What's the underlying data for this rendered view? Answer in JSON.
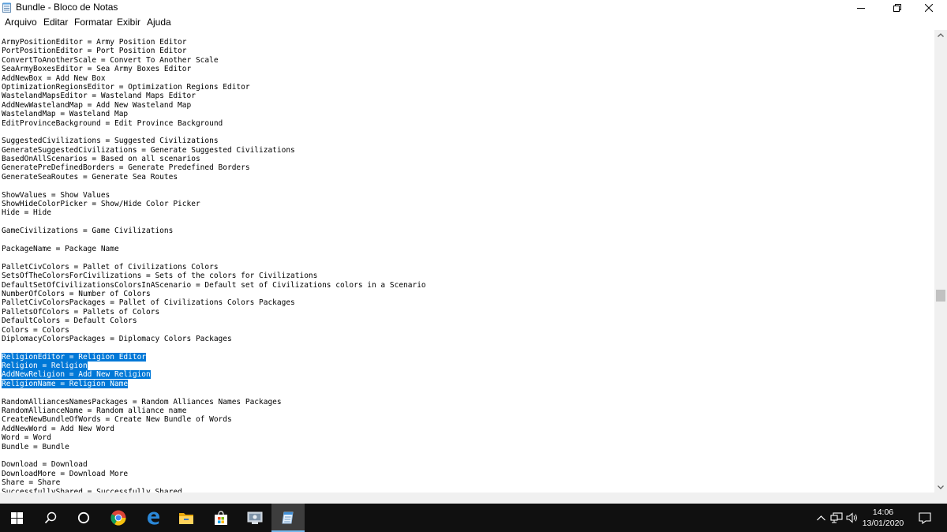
{
  "window": {
    "title": "Bundle - Bloco de Notas"
  },
  "menu": [
    "Arquivo",
    "Editar",
    "Formatar",
    "Exibir",
    "Ajuda"
  ],
  "editor": {
    "lines": [
      {
        "text": "ArmyPositionEditor = Army Position Editor"
      },
      {
        "text": "PortPositionEditor = Port Position Editor"
      },
      {
        "text": "ConvertToAnotherScale = Convert To Another Scale"
      },
      {
        "text": "SeaArmyBoxesEditor = Sea Army Boxes Editor"
      },
      {
        "text": "AddNewBox = Add New Box"
      },
      {
        "text": "OptimizationRegionsEditor = Optimization Regions Editor"
      },
      {
        "text": "WastelandMapsEditor = Wasteland Maps Editor"
      },
      {
        "text": "AddNewWastelandMap = Add New Wasteland Map"
      },
      {
        "text": "WastelandMap = Wasteland Map"
      },
      {
        "text": "EditProvinceBackground = Edit Province Background"
      },
      {
        "text": ""
      },
      {
        "text": "SuggestedCivilizations = Suggested Civilizations"
      },
      {
        "text": "GenerateSuggestedCivilizations = Generate Suggested Civilizations"
      },
      {
        "text": "BasedOnAllScenarios = Based on all scenarios"
      },
      {
        "text": "GeneratePreDefinedBorders = Generate Predefined Borders"
      },
      {
        "text": "GenerateSeaRoutes = Generate Sea Routes"
      },
      {
        "text": ""
      },
      {
        "text": "ShowValues = Show Values"
      },
      {
        "text": "ShowHideColorPicker = Show/Hide Color Picker"
      },
      {
        "text": "Hide = Hide"
      },
      {
        "text": ""
      },
      {
        "text": "GameCivilizations = Game Civilizations"
      },
      {
        "text": ""
      },
      {
        "text": "PackageName = Package Name"
      },
      {
        "text": ""
      },
      {
        "text": "PalletCivColors = Pallet of Civilizations Colors"
      },
      {
        "text": "SetsOfTheColorsForCivilizations = Sets of the colors for Civilizations"
      },
      {
        "text": "DefaultSetOfCivilizationsColorsInAScenario = Default set of Civilizations colors in a Scenario"
      },
      {
        "text": "NumberOfColors = Number of Colors"
      },
      {
        "text": "PalletCivColorsPackages = Pallet of Civilizations Colors Packages"
      },
      {
        "text": "PalletsOfColors = Pallets of Colors"
      },
      {
        "text": "DefaultColors = Default Colors"
      },
      {
        "text": "Colors = Colors"
      },
      {
        "text": "DiplomacyColorsPackages = Diplomacy Colors Packages"
      },
      {
        "text": ""
      },
      {
        "text": "ReligionEditor = Religion Editor",
        "selected": true
      },
      {
        "text": "Religion = Religion",
        "selected": true
      },
      {
        "text": "AddNewReligion = Add New Religion",
        "selected": true
      },
      {
        "text": "ReligionName = Religion Name",
        "selected": true
      },
      {
        "text": ""
      },
      {
        "text": "RandomAlliancesNamesPackages = Random Alliances Names Packages"
      },
      {
        "text": "RandomAllianceName = Random alliance name"
      },
      {
        "text": "CreateNewBundleOfWords = Create New Bundle of Words"
      },
      {
        "text": "AddNewWord = Add New Word"
      },
      {
        "text": "Word = Word"
      },
      {
        "text": "Bundle = Bundle"
      },
      {
        "text": ""
      },
      {
        "text": "Download = Download"
      },
      {
        "text": "DownloadMore = Download More"
      },
      {
        "text": "Share = Share"
      },
      {
        "text": "SuccessfullyShared = Successfully Shared"
      }
    ]
  },
  "taskbar": {
    "items": [
      {
        "name": "start-button",
        "icon": "windows-logo-icon"
      },
      {
        "name": "search-button",
        "icon": "search-icon"
      },
      {
        "name": "task-view-button",
        "icon": "cortana-circle-icon"
      },
      {
        "name": "chrome-taskbar-item",
        "icon": "chrome-icon"
      },
      {
        "name": "edge-taskbar-item",
        "icon": "edge-icon"
      },
      {
        "name": "file-explorer-taskbar-item",
        "icon": "folder-icon"
      },
      {
        "name": "store-taskbar-item",
        "icon": "store-bag-icon"
      },
      {
        "name": "app-taskbar-item",
        "icon": "app-icon"
      },
      {
        "name": "notepad-taskbar-item",
        "icon": "notepad-icon",
        "active": true
      }
    ],
    "tray": {
      "time": "14:06",
      "date": "13/01/2020"
    }
  },
  "colors": {
    "selection": "#0078d7",
    "taskbar": "#101010",
    "active_indicator": "#76b9ed"
  }
}
